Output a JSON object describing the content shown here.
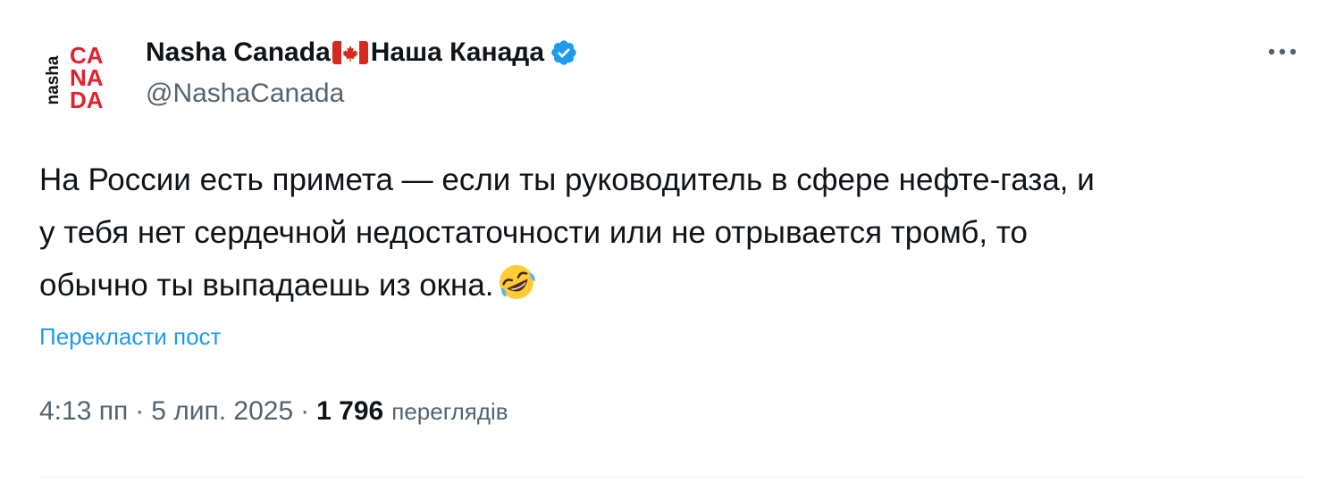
{
  "author": {
    "name_latin": "Nasha Canada",
    "name_cyrillic": "Наша Канада",
    "handle": "@NashaCanada",
    "avatar": {
      "vertical_text": "nasha",
      "stack": [
        "CA",
        "NA",
        "DA"
      ],
      "brand_color": "#e0232e"
    },
    "flag_icon": "canada-flag-icon",
    "verified_icon": "verified-badge-icon",
    "verified_color": "#1d9bf0"
  },
  "more_icon": "more-options-icon",
  "post": {
    "lines": [
      "На России есть примета — если ты руководитель в сфере  нефте-газа, и",
      "у тебя нет сердечной недостаточности или не отрывается тромб, то",
      "обычно ты выпадаешь из окна."
    ],
    "emoji": "rolling-on-floor-laughing-emoji"
  },
  "translate_label": "Перекласти пост",
  "meta": {
    "time": "4:13 пп",
    "separator": "·",
    "date": "5 лип. 2025",
    "views_count": "1 796",
    "views_label": "переглядів"
  },
  "colors": {
    "text": "#0f1419",
    "secondary": "#536471",
    "link": "#1d9bf0"
  }
}
